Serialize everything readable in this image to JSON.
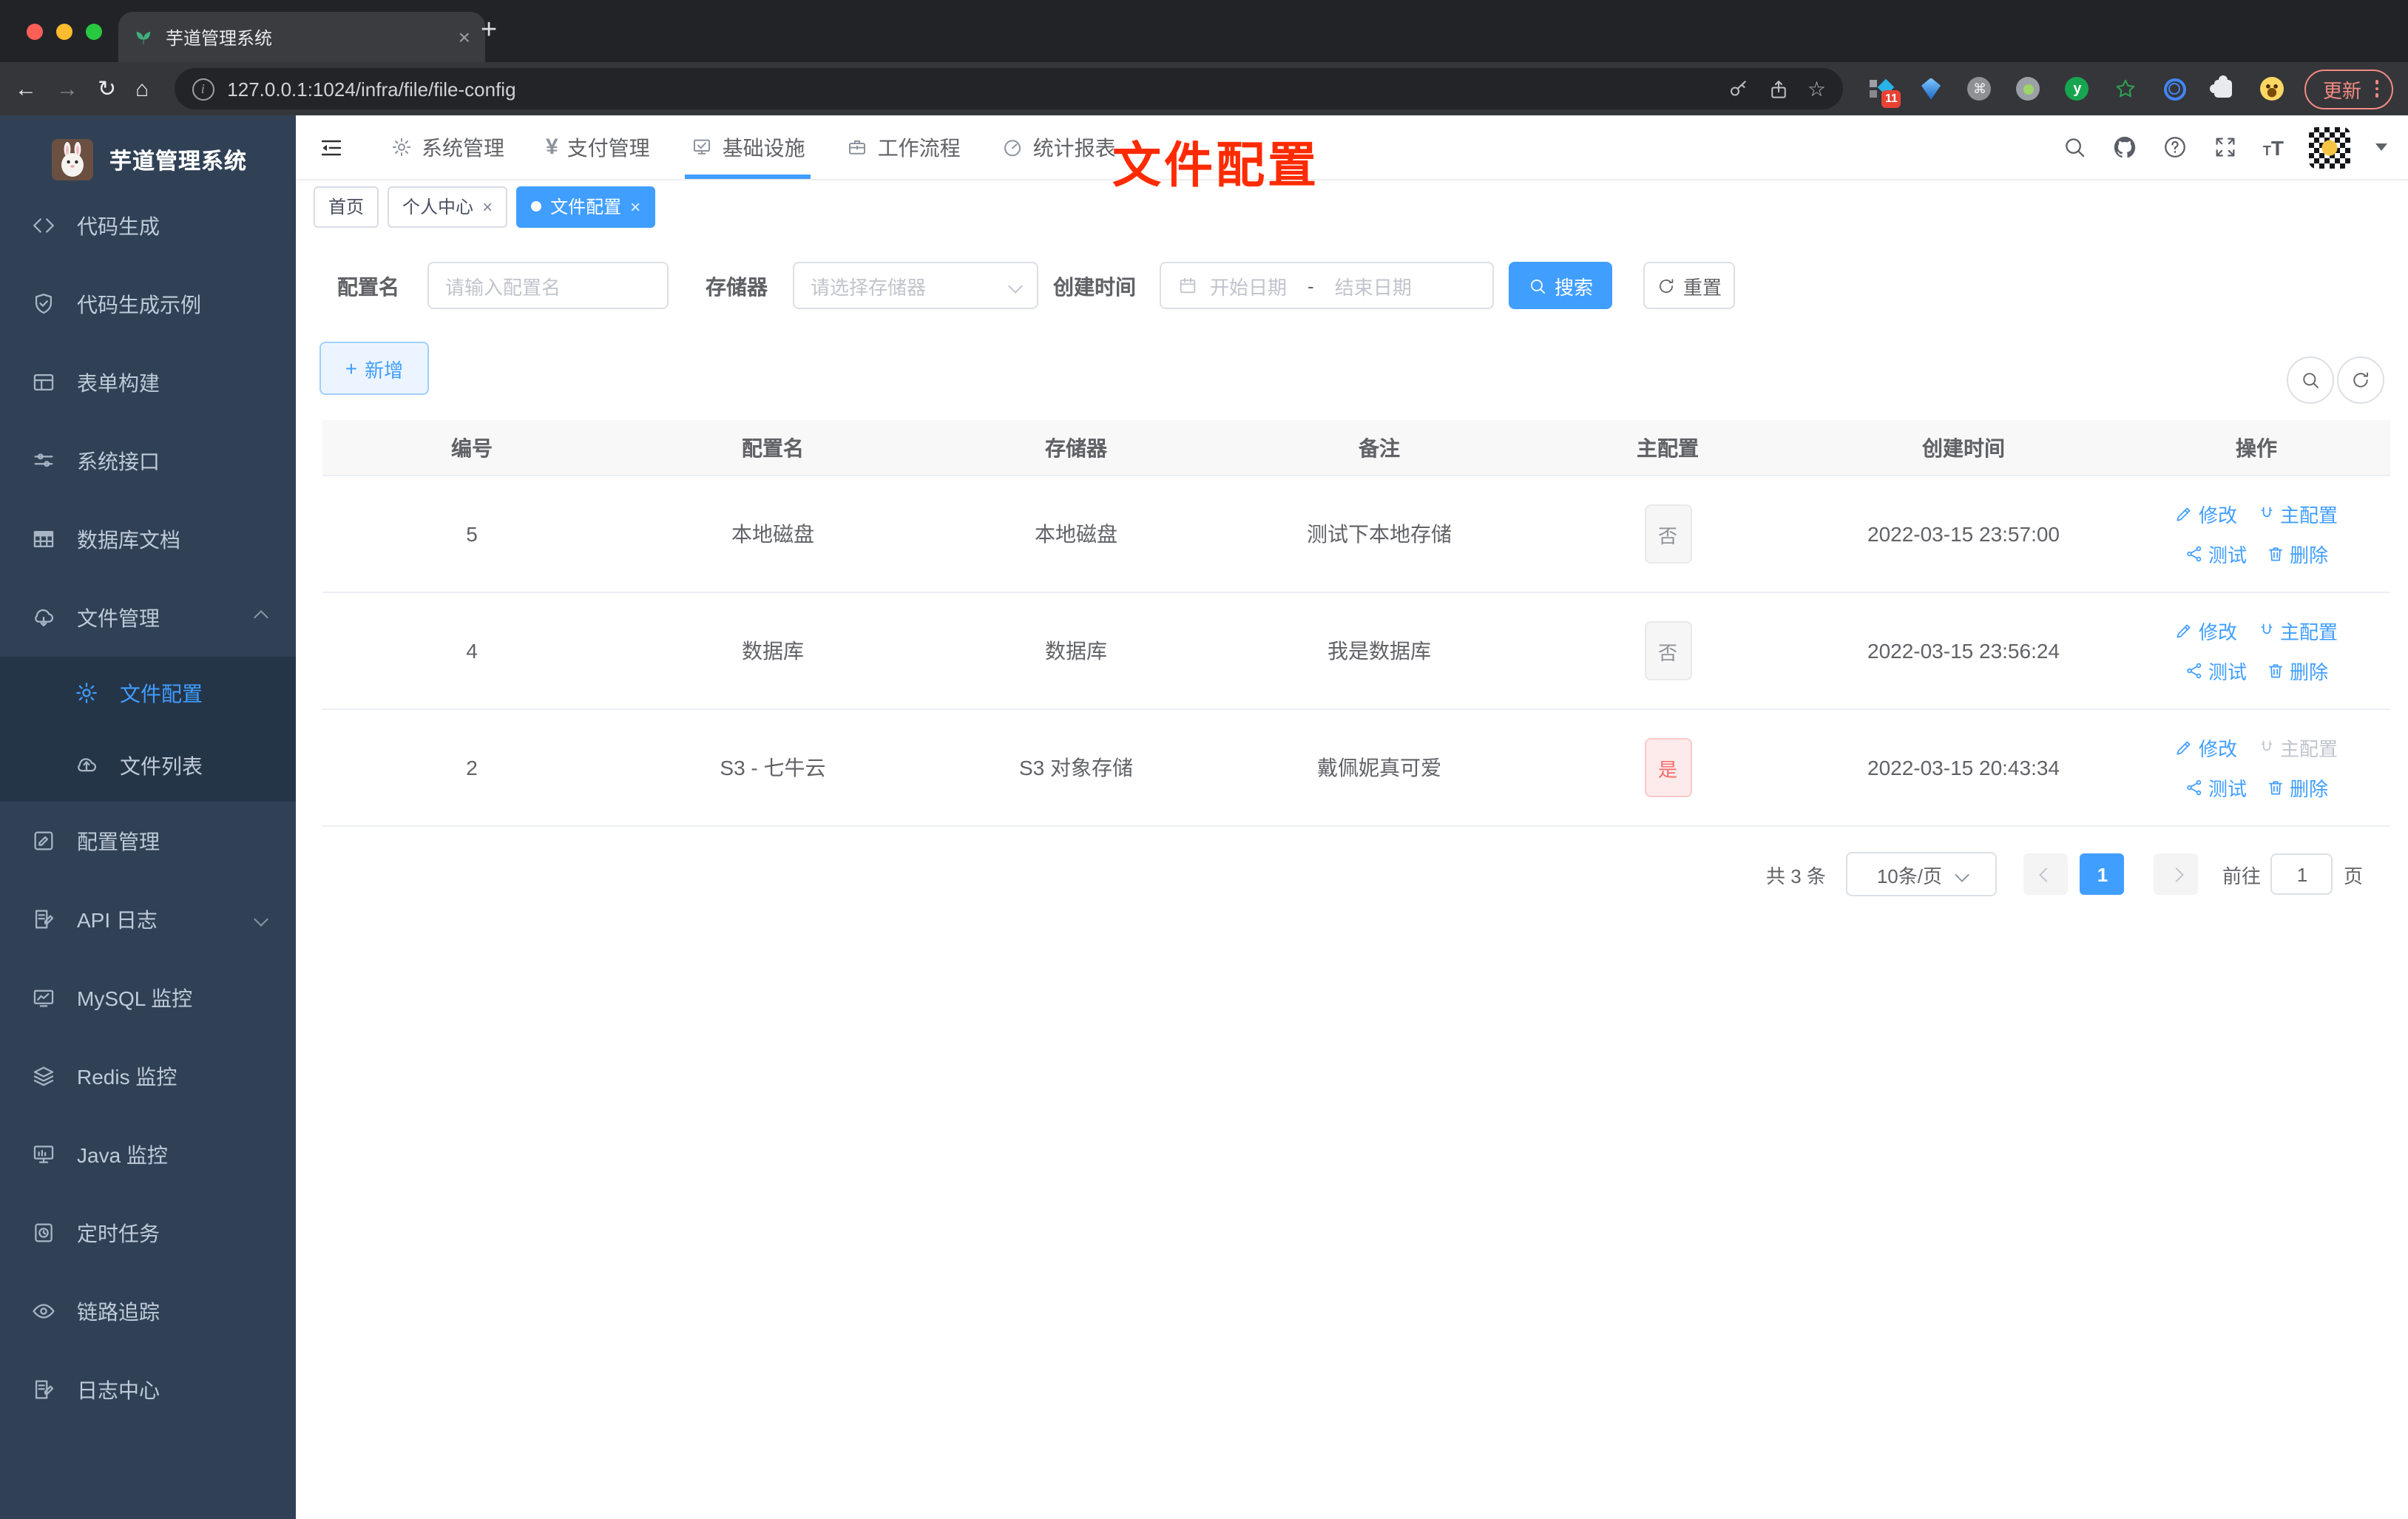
{
  "browser": {
    "tab_title": "芋道管理系统",
    "url": "127.0.0.1:1024/infra/file/file-config",
    "update_label": "更新",
    "extension_badge": "11",
    "icons": {
      "back": "←",
      "forward": "→",
      "reload": "↻",
      "home": "⌂",
      "info": "i",
      "close": "×",
      "new_tab": "+",
      "command": "⌘",
      "star": "☆",
      "ext_y": "y"
    }
  },
  "sidebar": {
    "title": "芋道管理系统",
    "items": [
      {
        "label": "代码生成"
      },
      {
        "label": "代码生成示例"
      },
      {
        "label": "表单构建"
      },
      {
        "label": "系统接口"
      },
      {
        "label": "数据库文档"
      },
      {
        "label": "文件管理"
      },
      {
        "label": "文件配置"
      },
      {
        "label": "文件列表"
      },
      {
        "label": "配置管理"
      },
      {
        "label": "API 日志"
      },
      {
        "label": "MySQL 监控"
      },
      {
        "label": "Redis 监控"
      },
      {
        "label": "Java 监控"
      },
      {
        "label": "定时任务"
      },
      {
        "label": "链路追踪"
      },
      {
        "label": "日志中心"
      }
    ]
  },
  "header": {
    "menus": [
      {
        "label": "系统管理"
      },
      {
        "label": "支付管理"
      },
      {
        "label": "基础设施"
      },
      {
        "label": "工作流程"
      },
      {
        "label": "统计报表"
      }
    ],
    "yen": "¥"
  },
  "tags": [
    {
      "label": "首页"
    },
    {
      "label": "个人中心"
    },
    {
      "label": "文件配置"
    }
  ],
  "annotation": {
    "text": "文件配置",
    "color": "#fe2b01"
  },
  "filters": {
    "name_label": "配置名",
    "name_placeholder": "请输入配置名",
    "storage_label": "存储器",
    "storage_placeholder": "请选择存储器",
    "time_label": "创建时间",
    "start_placeholder": "开始日期",
    "separator": "-",
    "end_placeholder": "结束日期",
    "search_label": "搜索",
    "reset_label": "重置"
  },
  "toolbar": {
    "add_label": "新增"
  },
  "table": {
    "headers": [
      "编号",
      "配置名",
      "存储器",
      "备注",
      "主配置",
      "创建时间",
      "操作"
    ],
    "actions": {
      "edit": "修改",
      "master": "主配置",
      "test": "测试",
      "delete": "删除"
    },
    "rows": [
      {
        "id": "5",
        "name": "本地磁盘",
        "storage": "本地磁盘",
        "remark": "测试下本地存储",
        "master": "否",
        "created": "2022-03-15 23:57:00"
      },
      {
        "id": "4",
        "name": "数据库",
        "storage": "数据库",
        "remark": "我是数据库",
        "master": "否",
        "created": "2022-03-15 23:56:24"
      },
      {
        "id": "2",
        "name": "S3 - 七牛云",
        "storage": "S3 对象存储",
        "remark": "戴佩妮真可爱",
        "master": "是",
        "created": "2022-03-15 20:43:34"
      }
    ]
  },
  "pagination": {
    "total": "共 3 条",
    "page_size": "10条/页",
    "page": "1",
    "goto_label": "前往",
    "goto_value": "1",
    "unit": "页"
  },
  "colors": {
    "primary": "#409eff",
    "danger": "#f56c6c",
    "sidebar_bg": "#304156"
  }
}
